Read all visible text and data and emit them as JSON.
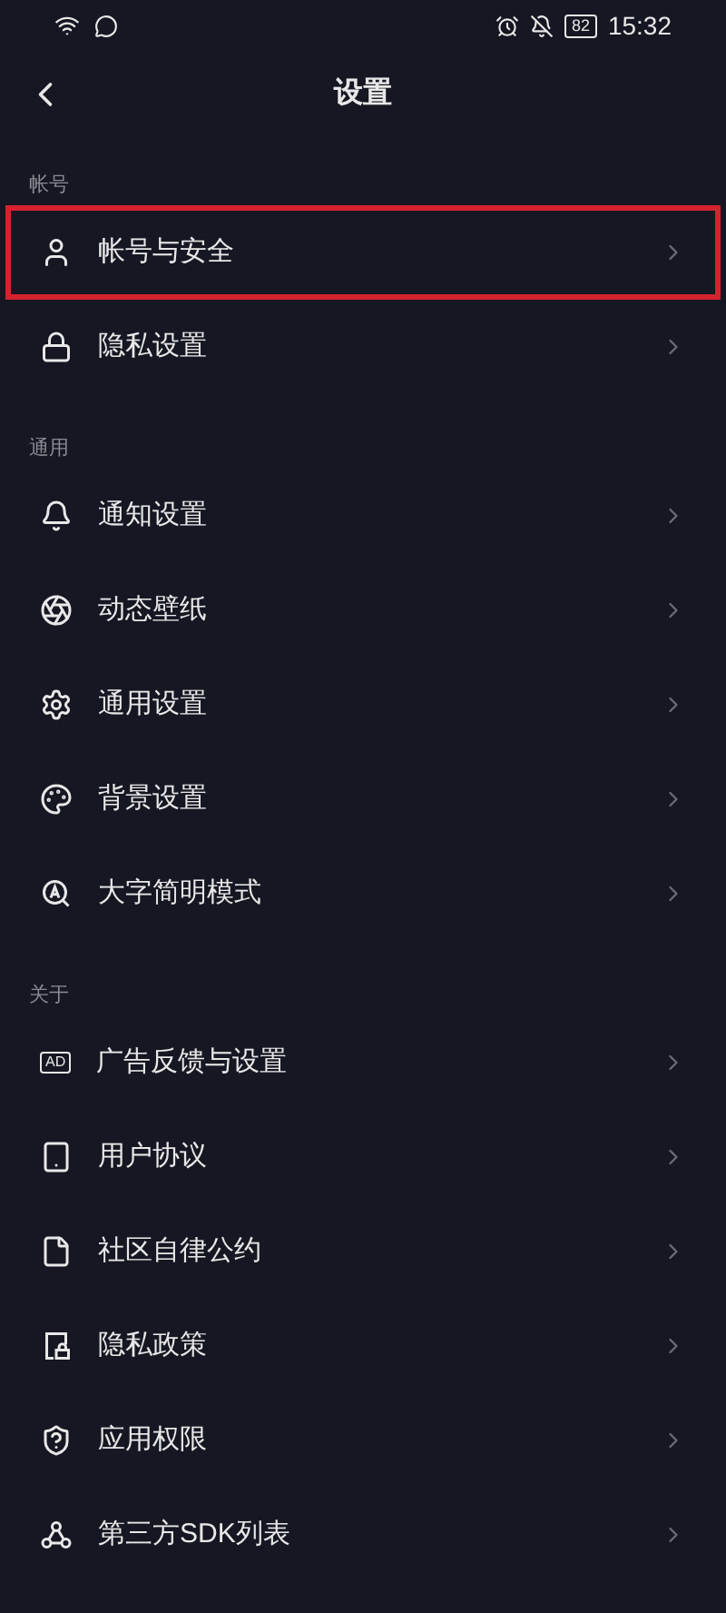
{
  "status_bar": {
    "time": "15:32",
    "battery": "82"
  },
  "header": {
    "title": "设置"
  },
  "sections": [
    {
      "title": "帐号",
      "items": [
        {
          "label": "帐号与安全",
          "highlighted": true
        },
        {
          "label": "隐私设置",
          "highlighted": false
        }
      ]
    },
    {
      "title": "通用",
      "items": [
        {
          "label": "通知设置",
          "highlighted": false
        },
        {
          "label": "动态壁纸",
          "highlighted": false
        },
        {
          "label": "通用设置",
          "highlighted": false
        },
        {
          "label": "背景设置",
          "highlighted": false
        },
        {
          "label": "大字简明模式",
          "highlighted": false
        }
      ]
    },
    {
      "title": "关于",
      "items": [
        {
          "label": "广告反馈与设置",
          "highlighted": false,
          "badge": "AD"
        },
        {
          "label": "用户协议",
          "highlighted": false
        },
        {
          "label": "社区自律公约",
          "highlighted": false
        },
        {
          "label": "隐私政策",
          "highlighted": false
        },
        {
          "label": "应用权限",
          "highlighted": false
        },
        {
          "label": "第三方SDK列表",
          "highlighted": false
        }
      ]
    }
  ]
}
